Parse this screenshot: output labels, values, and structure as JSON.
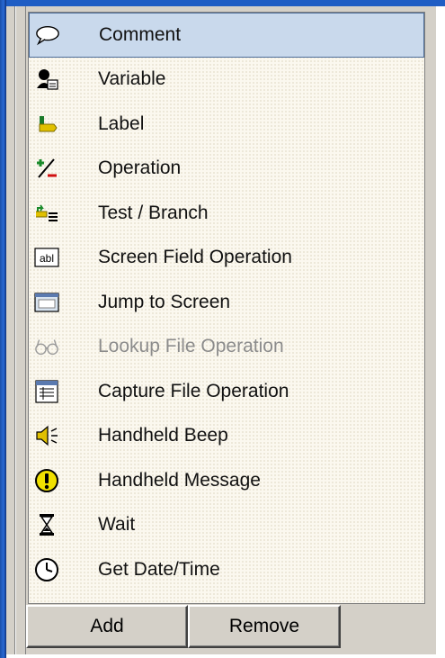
{
  "steps_list": {
    "items": [
      {
        "label": "Comment",
        "icon": "speech-bubble-icon",
        "selected": true,
        "disabled": false
      },
      {
        "label": "Variable",
        "icon": "variable-icon",
        "selected": false,
        "disabled": false
      },
      {
        "label": "Label",
        "icon": "label-tag-icon",
        "selected": false,
        "disabled": false
      },
      {
        "label": "Operation",
        "icon": "plus-minus-icon",
        "selected": false,
        "disabled": false
      },
      {
        "label": "Test / Branch",
        "icon": "branch-icon",
        "selected": false,
        "disabled": false
      },
      {
        "label": "Screen Field Operation",
        "icon": "textbox-abl-icon",
        "selected": false,
        "disabled": false
      },
      {
        "label": "Jump to Screen",
        "icon": "screen-window-icon",
        "selected": false,
        "disabled": false
      },
      {
        "label": "Lookup File Operation",
        "icon": "glasses-icon",
        "selected": false,
        "disabled": true
      },
      {
        "label": "Capture File Operation",
        "icon": "capture-form-icon",
        "selected": false,
        "disabled": false
      },
      {
        "label": "Handheld Beep",
        "icon": "speaker-icon",
        "selected": false,
        "disabled": false
      },
      {
        "label": "Handheld Message",
        "icon": "exclamation-icon",
        "selected": false,
        "disabled": false
      },
      {
        "label": "Wait",
        "icon": "hourglass-icon",
        "selected": false,
        "disabled": false
      },
      {
        "label": "Get Date/Time",
        "icon": "clock-icon",
        "selected": false,
        "disabled": false
      }
    ]
  },
  "buttons": {
    "add_label": "Add",
    "remove_label": "Remove"
  },
  "colors": {
    "selection_bg": "#c9d9ec",
    "list_bg": "#fbf8ef",
    "frame_blue": "#1f5dc4"
  }
}
